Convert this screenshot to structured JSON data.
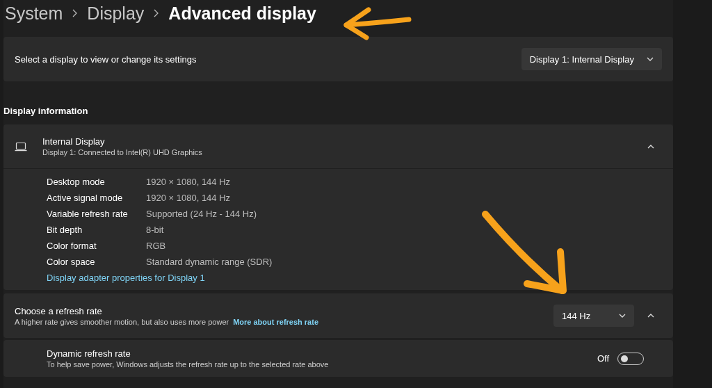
{
  "breadcrumb": [
    "System",
    "Display",
    "Advanced display"
  ],
  "display_select": {
    "label": "Select a display to view or change its settings",
    "dropdown": "Display 1: Internal Display"
  },
  "section_title": "Display information",
  "display_info": {
    "name": "Internal Display",
    "subtitle": "Display 1: Connected to Intel(R) UHD Graphics",
    "expanded": true,
    "details": [
      {
        "label": "Desktop mode",
        "value": "1920 × 1080, 144 Hz"
      },
      {
        "label": "Active signal mode",
        "value": "1920 × 1080, 144 Hz"
      },
      {
        "label": "Variable refresh rate",
        "value": "Supported (24 Hz - 144 Hz)"
      },
      {
        "label": "Bit depth",
        "value": "8-bit"
      },
      {
        "label": "Color format",
        "value": "RGB"
      },
      {
        "label": "Color space",
        "value": "Standard dynamic range (SDR)"
      }
    ],
    "link": "Display adapter properties for Display 1"
  },
  "refresh_rate": {
    "title": "Choose a refresh rate",
    "description": "A higher rate gives smoother motion, but also uses more power",
    "link": "More about refresh rate",
    "dropdown": "144 Hz",
    "expanded": true
  },
  "dynamic_refresh": {
    "title": "Dynamic refresh rate",
    "description": "To help save power, Windows adjusts the refresh rate up to the selected rate above",
    "toggle_label": "Off",
    "on": false
  }
}
